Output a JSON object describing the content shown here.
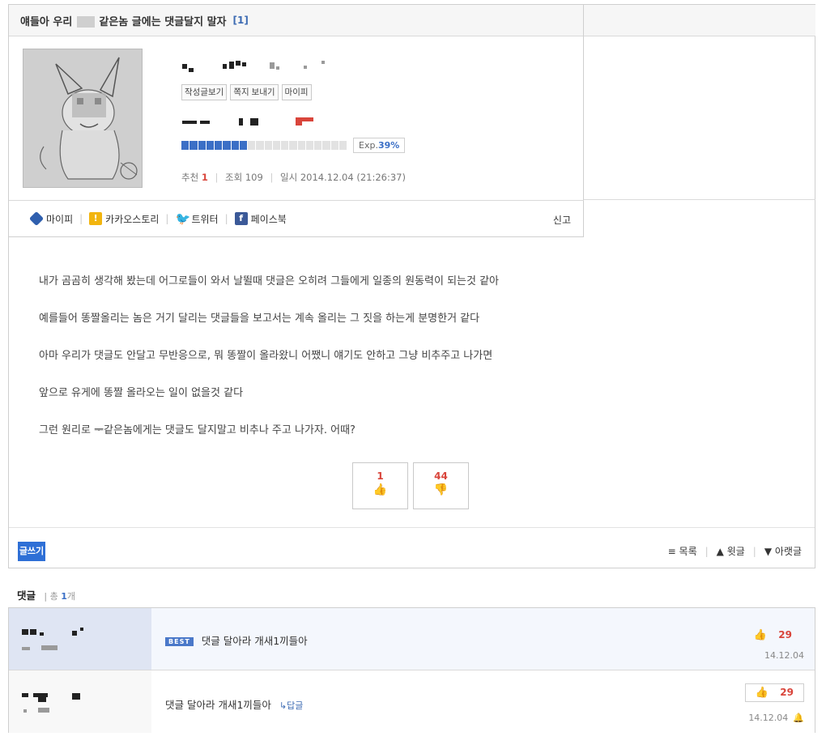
{
  "post": {
    "title_part1": "얘들아 우리",
    "title_part2": "같은놈 글에는 댓글달지 말자",
    "title_count": "[1]",
    "buttons": [
      "작성글보기",
      "쪽지 보내기",
      "마이피"
    ],
    "exp_label": "Exp.",
    "exp_value": "39%",
    "exp_fraction": 0.39,
    "meta": {
      "recommend_label": "추천",
      "recommend_value": "1",
      "views_label": "조회",
      "views_value": "109",
      "date_label": "일시",
      "date_value": "2014.12.04 (21:26:37)"
    },
    "share": {
      "mypi": "마이피",
      "kakao": "카카오스토리",
      "twitter": "트위터",
      "facebook": "페이스북",
      "report": "신고"
    },
    "body": [
      "내가 곰곰히 생각해 봤는데 어그로들이 와서 날뛸때 댓글은 오히려 그들에게 일종의 원동력이 되는것 같아",
      "예를들어 똥짤올리는 놈은 거기 달리는 댓글들을 보고서는 계속 올리는 그 짓을 하는게 분명한거 같다",
      "아마 우리가 댓글도 안달고 무반응으로, 뭐 똥짤이 올라왔니 어쨌니 얘기도 안하고 그냥 비추주고 나가면",
      "앞으로 유게에 똥짤 올라오는 일이 없을것 같다",
      "그런 원리로 ᆕ같은놈에게는 댓글도 달지말고 비추나 주고 나가자. 어때?"
    ],
    "votes": {
      "up": "1",
      "down": "44"
    },
    "write_button": "글쓰기",
    "nav": {
      "list": "≡ 목록",
      "prev": "▲ 윗글",
      "next": "▼ 아랫글"
    }
  },
  "comments": {
    "header": "댓글",
    "total_label": "총",
    "total_value": "1",
    "total_unit": "개",
    "items": [
      {
        "best": "BEST",
        "text": "댓글 달아라 개새1끼들아",
        "likes": "29",
        "date": "14.12.04"
      },
      {
        "text": "댓글 달아라 개새1끼들아",
        "reply": "↳답글",
        "likes": "29",
        "date": "14.12.04"
      }
    ]
  },
  "colors": {
    "accent": "#2e6fd6",
    "vote_red": "#d9453b",
    "best_row_bg": "#f4f7fd"
  }
}
